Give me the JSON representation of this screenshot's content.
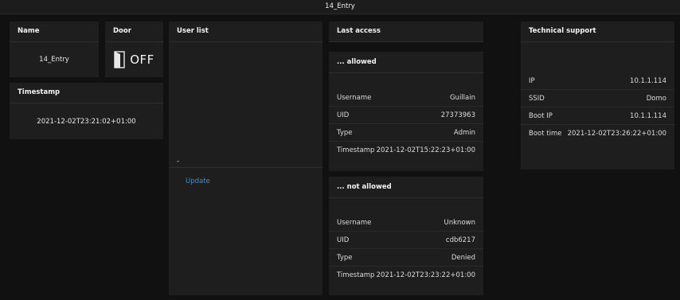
{
  "window": {
    "title": "14_Entry"
  },
  "name_card": {
    "title": "Name",
    "value": "14_Entry"
  },
  "door_card": {
    "title": "Door",
    "state": "OFF"
  },
  "timestamp_card": {
    "title": "Timestamp",
    "value": "2021-12-02T23:21:02+01:00"
  },
  "user_list": {
    "title": "User list",
    "value": "-",
    "update_label": "Update"
  },
  "last_access": {
    "title": "Last access",
    "allowed": {
      "title": "... allowed",
      "rows": [
        {
          "label": "Username",
          "value": "Guillain"
        },
        {
          "label": "UID",
          "value": "27373963"
        },
        {
          "label": "Type",
          "value": "Admin"
        },
        {
          "label": "Timestamp",
          "value": "2021-12-02T15:22:23+01:00"
        }
      ]
    },
    "not_allowed": {
      "title": "... not allowed",
      "rows": [
        {
          "label": "Username",
          "value": "Unknown"
        },
        {
          "label": "UID",
          "value": "cdb6217"
        },
        {
          "label": "Type",
          "value": "Denied"
        },
        {
          "label": "Timestamp",
          "value": "2021-12-02T23:23:22+01:00"
        }
      ]
    }
  },
  "tech_support": {
    "title": "Technical support",
    "rows": [
      {
        "label": "IP",
        "value": "10.1.1.114"
      },
      {
        "label": "SSID",
        "value": "Domo"
      },
      {
        "label": "Boot IP",
        "value": "10.1.1.114"
      },
      {
        "label": "Boot time",
        "value": "2021-12-02T23:26:22+01:00"
      }
    ]
  }
}
